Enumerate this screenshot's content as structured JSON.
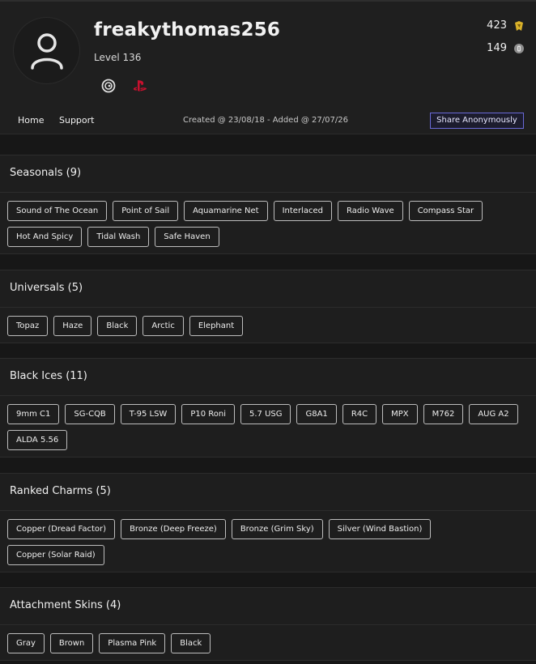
{
  "profile": {
    "username": "freakythomas256",
    "level": "Level 136",
    "stat_one": "423",
    "stat_two": "149",
    "platforms": [
      "ubisoft-icon",
      "playstation-icon"
    ]
  },
  "nav": {
    "home": "Home",
    "support": "Support",
    "created": "Created @ 23/08/18 - Added @ 27/07/26",
    "share": "Share Anonymously"
  },
  "colors": {
    "accent": "#6a6ad8",
    "playstation": "#c8102e",
    "stat_gold": "#d9b12a"
  },
  "sections": [
    {
      "title": "Seasonals (9)",
      "items": [
        "Sound of The Ocean",
        "Point of Sail",
        "Aquamarine Net",
        "Interlaced",
        "Radio Wave",
        "Compass Star",
        "Hot And Spicy",
        "Tidal Wash",
        "Safe Haven"
      ]
    },
    {
      "title": "Universals (5)",
      "items": [
        "Topaz",
        "Haze",
        "Black",
        "Arctic",
        "Elephant"
      ]
    },
    {
      "title": "Black Ices (11)",
      "items": [
        "9mm C1",
        "SG-CQB",
        "T-95 LSW",
        "P10 Roni",
        "5.7 USG",
        "G8A1",
        "R4C",
        "MPX",
        "M762",
        "AUG A2",
        "ALDA 5.56"
      ]
    },
    {
      "title": "Ranked Charms (5)",
      "items": [
        "Copper (Dread Factor)",
        "Bronze (Deep Freeze)",
        "Bronze (Grim Sky)",
        "Silver (Wind Bastion)",
        "Copper (Solar Raid)"
      ]
    },
    {
      "title": "Attachment Skins (4)",
      "items": [
        "Gray",
        "Brown",
        "Plasma Pink",
        "Black"
      ]
    }
  ]
}
